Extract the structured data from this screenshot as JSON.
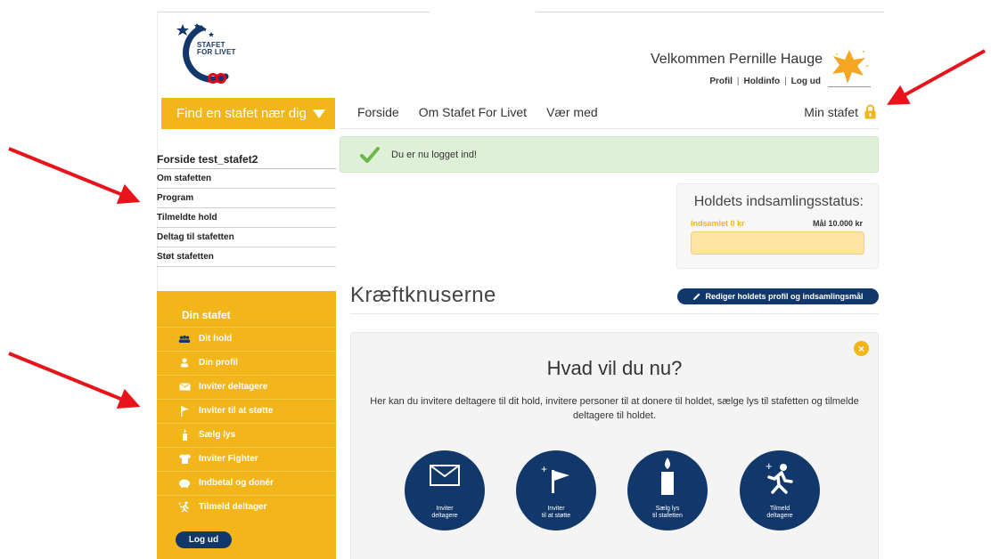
{
  "logo": {
    "line1": "STAFET",
    "line2": "FOR LIVET"
  },
  "header": {
    "welcome": "Velkommen Pernille Hauge",
    "links": [
      "Profil",
      "Holdinfo",
      "Log ud"
    ]
  },
  "find_bar": {
    "label": "Find en stafet nær dig"
  },
  "nav": {
    "items": [
      "Forside",
      "Om Stafet For Livet",
      "Vær med"
    ],
    "my_relay": "Min stafet"
  },
  "alert": {
    "message": "Du er nu logget ind!"
  },
  "sidebar": {
    "heading": "Forside test_stafet2",
    "items": [
      "Om stafetten",
      "Program",
      "Tilmeldte hold",
      "Deltag til stafetten",
      "Støt stafetten"
    ]
  },
  "din_stafet": {
    "title": "Din stafet",
    "items": [
      "Dit hold",
      "Din profil",
      "Inviter deltagere",
      "Inviter til at støtte",
      "Sælg lys",
      "Inviter Fighter",
      "Indbetal og donér",
      "Tilmeld deltager"
    ],
    "logout": "Log ud"
  },
  "fundraising": {
    "title": "Holdets indsamlingsstatus:",
    "collected": "Indsamlet 0 kr",
    "goal": "Mål 10.000 kr",
    "progress": 0
  },
  "team": {
    "name": "Kræftknuserne",
    "edit_button": "Rediger holdets profil og indsamlingsmål"
  },
  "panel": {
    "heading": "Hvad vil du nu?",
    "description": "Her kan du invitere deltagere til dit hold, invitere personer til at donere til holdet, sælge lys til stafetten og tilmelde deltagere til holdet.",
    "actions": [
      {
        "line1": "Inviter",
        "line2": "deltagere",
        "icon": "envelope-icon"
      },
      {
        "line1": "Inviter",
        "line2": "til at støtte",
        "icon": "flag-icon"
      },
      {
        "line1": "Sælg lys",
        "line2": "til stafetten",
        "icon": "candle-icon"
      },
      {
        "line1": "Tilmeld",
        "line2": "deltagere",
        "icon": "runner-icon"
      }
    ]
  },
  "colors": {
    "yellow": "#f2b51a",
    "navy": "#12386b",
    "success_bg": "#dff0d8",
    "arrow": "#e8141b"
  }
}
